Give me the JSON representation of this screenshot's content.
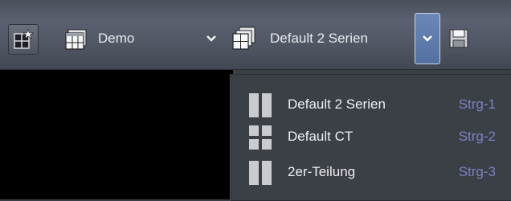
{
  "toolbar": {
    "layout_name": "Demo",
    "series_name": "Default 2 Serien"
  },
  "icons": {
    "favorite": "grid-star-icon",
    "layout": "layout-grid-icon",
    "series": "series-stack-icon",
    "dropdown": "chevron-down-icon",
    "save": "save-icon"
  },
  "menu": {
    "items": [
      {
        "label": "Default 2 Serien",
        "shortcut": "Strg-1",
        "icon": "two-column-icon"
      },
      {
        "label": "Default CT",
        "shortcut": "Strg-2",
        "icon": "four-grid-icon"
      },
      {
        "label": "2er-Teilung",
        "shortcut": "Strg-3",
        "icon": "two-column-icon"
      }
    ]
  },
  "colors": {
    "toolbar": "#525865",
    "menu_background": "#3b3f46",
    "shortcut_text": "#7b82c2",
    "dropdown_highlight": "#5f7cae"
  }
}
